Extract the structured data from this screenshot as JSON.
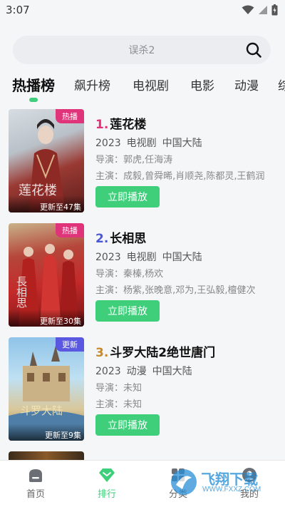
{
  "status": {
    "time": "3:07"
  },
  "search": {
    "placeholder": "误杀2"
  },
  "tabs": [
    {
      "label": "热播榜",
      "active": true
    },
    {
      "label": "飙升榜",
      "active": false
    },
    {
      "label": "电视剧",
      "active": false
    },
    {
      "label": "电影",
      "active": false
    },
    {
      "label": "动漫",
      "active": false
    },
    {
      "label": "综",
      "active": false
    }
  ],
  "items": [
    {
      "rank": "1.",
      "title": "莲花楼",
      "year": "2023",
      "type": "电视剧",
      "region": "中国大陆",
      "director": "导演：郭虎,任海涛",
      "cast": "主演：成毅,曾舜晞,肖顺尧,陈都灵,王鹤润",
      "badge": "热播",
      "episodes": "更新至47集",
      "poster_text": "莲花楼",
      "play_label": "立即播放"
    },
    {
      "rank": "2.",
      "title": "长相思",
      "year": "2023",
      "type": "电视剧",
      "region": "中国大陆",
      "director": "导演：秦榛,杨欢",
      "cast": "主演：杨紫,张晚意,邓为,王弘毅,檀健次",
      "badge": "热播",
      "episodes": "更新至30集",
      "poster_text": "長相思",
      "play_label": "立即播放"
    },
    {
      "rank": "3.",
      "title": "斗罗大陆2绝世唐门",
      "year": "2023",
      "type": "动漫",
      "region": "中国大陆",
      "director": "导演：未知",
      "cast": "主演：未知",
      "badge": "更新",
      "episodes": "更新至9集",
      "poster_text": "斗罗大陆",
      "play_label": "立即播放"
    }
  ],
  "nav": [
    {
      "label": "首页",
      "icon": "home-icon"
    },
    {
      "label": "排行",
      "icon": "ranking-icon",
      "active": true
    },
    {
      "label": "分类",
      "icon": "category-icon"
    },
    {
      "label": "我的",
      "icon": "profile-icon"
    }
  ],
  "watermark": {
    "text": "飞翔下载",
    "url": "WWW.FXXZ.COM"
  },
  "colors": {
    "accent": "#3fcf7b",
    "rank1": "#e0347a",
    "rank2": "#4a57d6",
    "rank3": "#c98a2a",
    "badge_hot": "#e0347a",
    "badge_update": "#5a58e0"
  }
}
